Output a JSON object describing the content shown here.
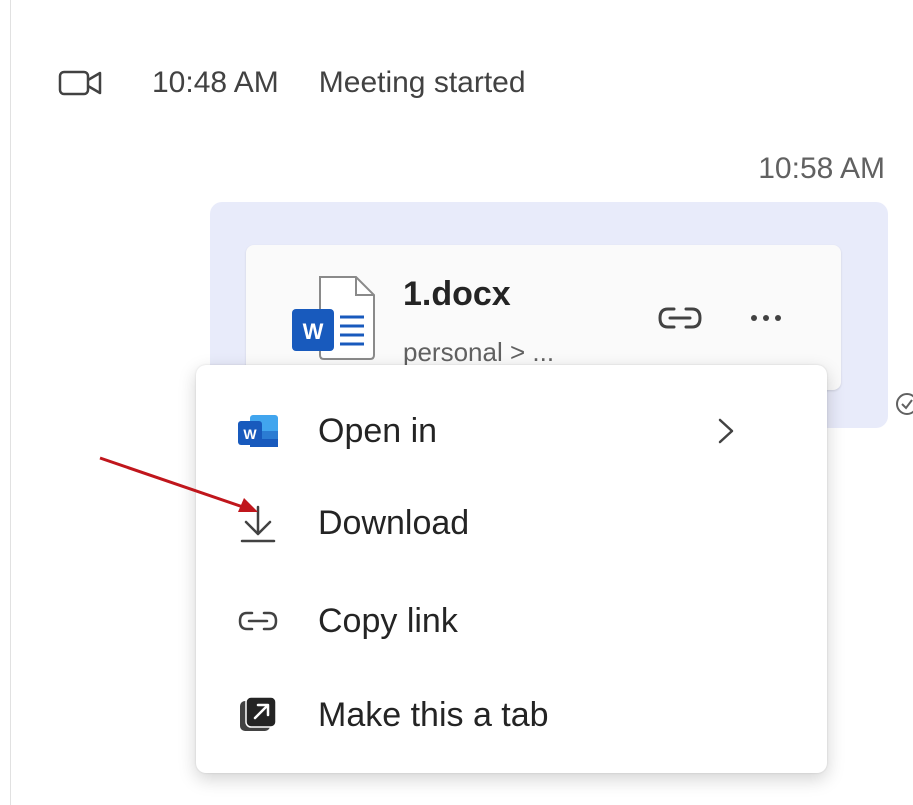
{
  "meeting": {
    "icon": "video-camera-icon",
    "time": "10:48 AM",
    "label": "Meeting started"
  },
  "message": {
    "timestamp": "10:58 AM",
    "bubble_color": "#e8ebfa"
  },
  "file_card": {
    "file_icon": "word-document-icon",
    "file_name": "1.docx",
    "file_path": "personal > ...",
    "link_icon": "link-icon",
    "more_icon": "more-options-icon"
  },
  "context_menu": {
    "items": [
      {
        "id": "open-in",
        "icon": "word-app-icon",
        "label": "Open in",
        "has_submenu": true
      },
      {
        "id": "download",
        "icon": "download-icon",
        "label": "Download",
        "has_submenu": false
      },
      {
        "id": "copy-link",
        "icon": "link-icon",
        "label": "Copy link",
        "has_submenu": false
      },
      {
        "id": "make-tab",
        "icon": "open-in-tab-icon",
        "label": "Make this a tab",
        "has_submenu": false
      }
    ]
  },
  "colors": {
    "word_blue": "#185abd",
    "word_light_blue": "#41a5ee",
    "annotation_arrow": "#c0161c",
    "text_primary": "#242424",
    "text_secondary": "#616161"
  }
}
